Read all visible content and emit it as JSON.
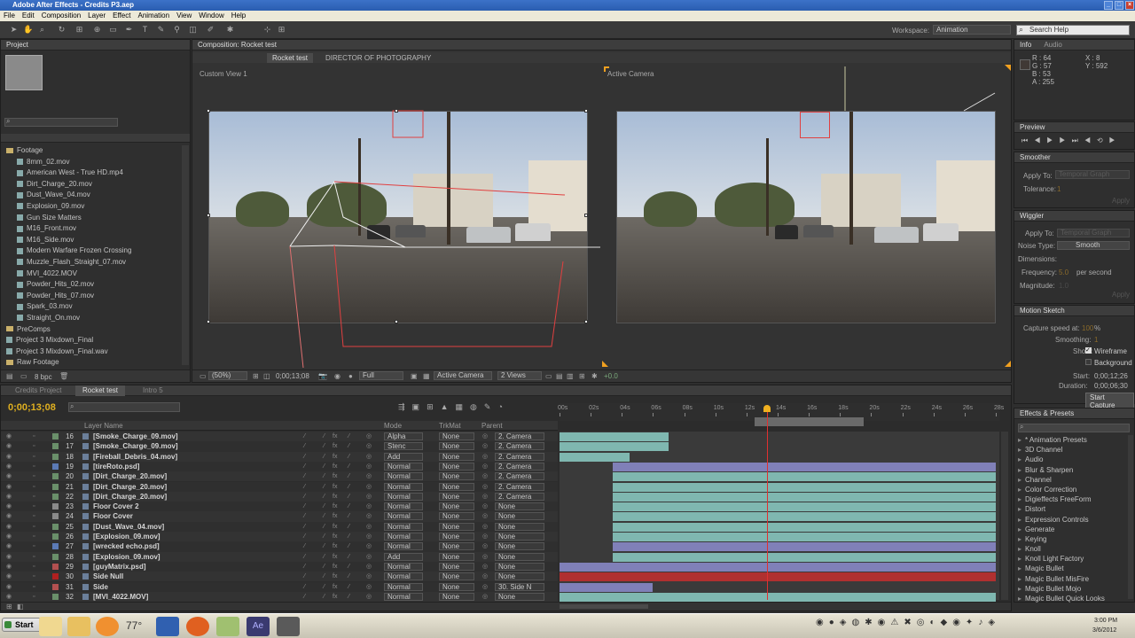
{
  "window": {
    "title": "Adobe After Effects - Credits P3.aep",
    "controls": [
      "_",
      "□",
      "×"
    ]
  },
  "menu": [
    "File",
    "Edit",
    "Composition",
    "Layer",
    "Effect",
    "Animation",
    "View",
    "Window",
    "Help"
  ],
  "toolbar": {
    "workspace_label": "Workspace:",
    "workspace_value": "Animation",
    "search_placeholder": "Search Help"
  },
  "project": {
    "tab": "Project",
    "search_placeholder": "",
    "bit_depth": "8 bpc",
    "items": [
      {
        "type": "folder",
        "name": "Footage",
        "indent": 0
      },
      {
        "type": "file",
        "name": "8mm_02.mov",
        "indent": 1
      },
      {
        "type": "file",
        "name": "American West - True HD.mp4",
        "indent": 1
      },
      {
        "type": "file",
        "name": "Dirt_Charge_20.mov",
        "indent": 1
      },
      {
        "type": "file",
        "name": "Dust_Wave_04.mov",
        "indent": 1
      },
      {
        "type": "file",
        "name": "Explosion_09.mov",
        "indent": 1
      },
      {
        "type": "file",
        "name": "Gun Size Matters",
        "indent": 1
      },
      {
        "type": "file",
        "name": "M16_Front.mov",
        "indent": 1
      },
      {
        "type": "file",
        "name": "M16_Side.mov",
        "indent": 1
      },
      {
        "type": "file",
        "name": "Modern Warfare Frozen Crossing",
        "indent": 1
      },
      {
        "type": "file",
        "name": "Muzzle_Flash_Straight_07.mov",
        "indent": 1
      },
      {
        "type": "file",
        "name": "MVI_4022.MOV",
        "indent": 1
      },
      {
        "type": "file",
        "name": "Powder_Hits_02.mov",
        "indent": 1
      },
      {
        "type": "file",
        "name": "Powder_Hits_07.mov",
        "indent": 1
      },
      {
        "type": "file",
        "name": "Spark_03.mov",
        "indent": 1
      },
      {
        "type": "file",
        "name": "Straight_On.mov",
        "indent": 1
      },
      {
        "type": "folder",
        "name": "PreComps",
        "indent": 0
      },
      {
        "type": "file",
        "name": "Project 3 Mixdown_Final",
        "indent": 0
      },
      {
        "type": "file",
        "name": "Project 3 Mixdown_Final.wav",
        "indent": 0
      },
      {
        "type": "folder",
        "name": "Raw Footage",
        "indent": 0
      }
    ]
  },
  "composition": {
    "panel_title": "Composition: Rocket test",
    "breadcrumb": [
      "Rocket test",
      "DIRECTOR OF PHOTOGRAPHY"
    ],
    "left_view_label": "Custom View 1",
    "right_view_label": "Active Camera",
    "zoom": "(50%)",
    "timecode": "0;00;13;08",
    "resolution": "Full",
    "camera": "Active Camera",
    "views": "2 Views",
    "exposure": "+0.0"
  },
  "info": {
    "tabs": [
      "Info",
      "Audio"
    ],
    "r": "R : 64",
    "g": "G : 57",
    "b": "B : 53",
    "a": "A : 255",
    "x": "X : 8",
    "y": "Y : 592"
  },
  "preview": {
    "tab": "Preview"
  },
  "smoother": {
    "tab": "Smoother",
    "apply_to_label": "Apply To:",
    "apply_to_value": "Temporal Graph",
    "tolerance_label": "Tolerance:",
    "tolerance_value": "1",
    "apply_btn": "Apply"
  },
  "wiggler": {
    "tab": "Wiggler",
    "apply_to_label": "Apply To:",
    "apply_to_value": "Temporal Graph",
    "noise_label": "Noise Type:",
    "noise_value": "Smooth",
    "dimensions_label": "Dimensions:",
    "frequency_label": "Frequency:",
    "frequency_value": "5.0",
    "frequency_unit": "per second",
    "magnitude_label": "Magnitude:",
    "magnitude_value": "1.0",
    "apply_btn": "Apply"
  },
  "motion_sketch": {
    "tab": "Motion Sketch",
    "capture_label": "Capture speed at:",
    "capture_value": "100",
    "capture_unit": "%",
    "smoothing_label": "Smoothing:",
    "smoothing_value": "1",
    "show_label": "Show:",
    "wireframe": "Wireframe",
    "background": "Background",
    "start_label": "Start:",
    "start_value": "0;00;12;26",
    "duration_label": "Duration:",
    "duration_value": "0;00;06;30",
    "start_capture_btn": "Start Capture"
  },
  "effects": {
    "tab": "Effects & Presets",
    "categories": [
      "* Animation Presets",
      "3D Channel",
      "Audio",
      "Blur & Sharpen",
      "Channel",
      "Color Correction",
      "Digieffects FreeForm",
      "Distort",
      "Expression Controls",
      "Generate",
      "Keying",
      "Knoll",
      "Knoll Light Factory",
      "Magic Bullet",
      "Magic Bullet MisFire",
      "Magic Bullet Mojo",
      "Magic Bullet Quick Looks"
    ]
  },
  "timeline": {
    "tabs": [
      "Credits Project",
      "Rocket test",
      "Intro 5"
    ],
    "current_time": "0;00;13;08",
    "col_layer_name": "Layer Name",
    "col_mode": "Mode",
    "col_trkmat": "TrkMat",
    "col_parent": "Parent",
    "ruler": [
      "00s",
      "02s",
      "04s",
      "06s",
      "08s",
      "10s",
      "12s",
      "14s",
      "16s",
      "18s",
      "20s",
      "22s",
      "24s",
      "26s",
      "28s"
    ],
    "playhead_seconds": 13.3,
    "duration_seconds": 28,
    "work_area": [
      12.5,
      19.5
    ],
    "layers": [
      {
        "num": "16",
        "name": "[Smoke_Charge_09.mov]",
        "mode": "Alpha",
        "trkmat": "None",
        "parent": "2. Camera",
        "color": "#6a8f6a",
        "start": 0,
        "end": 7,
        "bar": "#7fb7b0",
        "half": true
      },
      {
        "num": "17",
        "name": "[Smoke_Charge_09.mov]",
        "mode": "Stenc",
        "trkmat": "None",
        "parent": "2. Camera",
        "color": "#6a8f6a",
        "start": 0,
        "end": 7,
        "bar": "#7fb7b0",
        "half": true
      },
      {
        "num": "18",
        "name": "[Fireball_Debris_04.mov]",
        "mode": "Add",
        "trkmat": "None",
        "parent": "2. Camera",
        "color": "#6a8f6a",
        "start": 0,
        "end": 4.5,
        "bar": "#7fb7b0",
        "half": false
      },
      {
        "num": "19",
        "name": "[tireRoto.psd]",
        "mode": "Normal",
        "trkmat": "None",
        "parent": "2. Camera",
        "color": "#5b7ab5",
        "start": 3.4,
        "end": 28,
        "bar": "#8080b8",
        "half": false
      },
      {
        "num": "20",
        "name": "[Dirt_Charge_20.mov]",
        "mode": "Normal",
        "trkmat": "None",
        "parent": "2. Camera",
        "color": "#6a8f6a",
        "start": 3.4,
        "end": 28,
        "bar": "#7fb7b0",
        "half": false
      },
      {
        "num": "21",
        "name": "[Dirt_Charge_20.mov]",
        "mode": "Normal",
        "trkmat": "None",
        "parent": "2. Camera",
        "color": "#6a8f6a",
        "start": 3.4,
        "end": 28,
        "bar": "#7fb7b0",
        "half": false
      },
      {
        "num": "22",
        "name": "[Dirt_Charge_20.mov]",
        "mode": "Normal",
        "trkmat": "None",
        "parent": "2. Camera",
        "color": "#6a8f6a",
        "start": 3.4,
        "end": 28,
        "bar": "#7fb7b0",
        "half": false
      },
      {
        "num": "23",
        "name": "Floor Cover 2",
        "mode": "Normal",
        "trkmat": "None",
        "parent": "None",
        "color": "#8a8a8a",
        "start": 3.4,
        "end": 28,
        "bar": "#7fb7b0",
        "half": false
      },
      {
        "num": "24",
        "name": "Floor Cover",
        "mode": "Normal",
        "trkmat": "None",
        "parent": "None",
        "color": "#8a8a8a",
        "start": 3.4,
        "end": 28,
        "bar": "#7fb7b0",
        "half": false
      },
      {
        "num": "25",
        "name": "[Dust_Wave_04.mov]",
        "mode": "Normal",
        "trkmat": "None",
        "parent": "None",
        "color": "#6a8f6a",
        "start": 3.4,
        "end": 28,
        "bar": "#7fb7b0",
        "half": false
      },
      {
        "num": "26",
        "name": "[Explosion_09.mov]",
        "mode": "Normal",
        "trkmat": "None",
        "parent": "None",
        "color": "#6a8f6a",
        "start": 3.4,
        "end": 28,
        "bar": "#7fb7b0",
        "half": false
      },
      {
        "num": "27",
        "name": "[wrecked echo.psd]",
        "mode": "Normal",
        "trkmat": "None",
        "parent": "None",
        "color": "#5b7ab5",
        "start": 3.4,
        "end": 28,
        "bar": "#8080b8",
        "half": false
      },
      {
        "num": "28",
        "name": "[Explosion_09.mov]",
        "mode": "Add",
        "trkmat": "None",
        "parent": "None",
        "color": "#6a8f6a",
        "start": 3.4,
        "end": 28,
        "bar": "#7fb7b0",
        "half": false
      },
      {
        "num": "29",
        "name": "[guyMatrix.psd]",
        "mode": "Normal",
        "trkmat": "None",
        "parent": "None",
        "color": "#b25050",
        "start": 0,
        "end": 28,
        "bar": "#8080b8",
        "half": false
      },
      {
        "num": "30",
        "name": "Side Null",
        "mode": "Normal",
        "trkmat": "None",
        "parent": "None",
        "color": "#b02020",
        "start": 0,
        "end": 28,
        "bar": "#b03030",
        "half": false
      },
      {
        "num": "31",
        "name": "Side",
        "mode": "Normal",
        "trkmat": "None",
        "parent": "30. Side N",
        "color": "#b25050",
        "start": 0,
        "end": 6,
        "bar": "#8080b8",
        "half": false
      },
      {
        "num": "32",
        "name": "[MVI_4022.MOV]",
        "mode": "Normal",
        "trkmat": "None",
        "parent": "None",
        "color": "#6a8f6a",
        "start": 0,
        "end": 28,
        "bar": "#7fb7b0",
        "half": false
      }
    ]
  },
  "taskbar": {
    "start": "Start",
    "time": "3:00 PM",
    "date": "3/6/2012",
    "temp": "77°"
  },
  "colors": {
    "accent_orange": "#f0a020",
    "playhead": "#e03030",
    "timecode": "#e0b020"
  }
}
